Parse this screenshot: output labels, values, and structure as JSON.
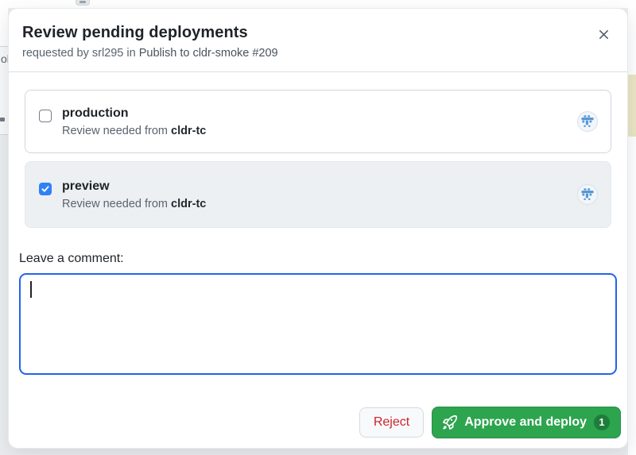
{
  "background": {
    "fragment_text": "ol"
  },
  "dialog": {
    "title": "Review pending deployments",
    "subtitle": {
      "prefix": "requested by",
      "user": "srl295",
      "joiner": "in",
      "workflow_run": "Publish to cldr-smoke #209"
    }
  },
  "environments": [
    {
      "name": "production",
      "checked": false,
      "review_prefix": "Review needed from",
      "team": "cldr-tc"
    },
    {
      "name": "preview",
      "checked": true,
      "review_prefix": "Review needed from",
      "team": "cldr-tc"
    }
  ],
  "comment": {
    "label": "Leave a comment:",
    "value": ""
  },
  "footer": {
    "reject_label": "Reject",
    "approve_label": "Approve and deploy",
    "pending_count": "1"
  },
  "colors": {
    "checkbox_accent": "#2f81f7",
    "textarea_focus_border": "#2463eb",
    "approve_green": "#2da44e",
    "reject_red": "#cf222e",
    "avatar_blue": "#5596d6"
  }
}
